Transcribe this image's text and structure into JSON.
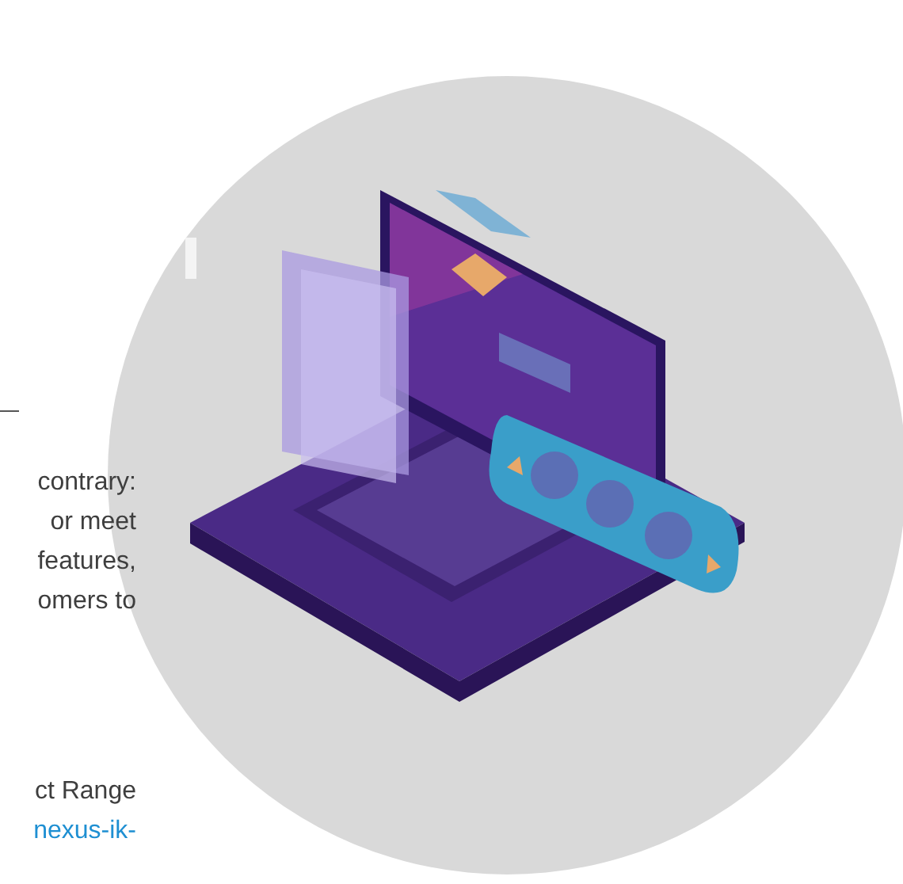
{
  "paragraph_lines": [
    "contrary:",
    "or meet",
    "features,",
    "omers to"
  ],
  "footer_line": "ct Range",
  "link": "nexus-ik-"
}
